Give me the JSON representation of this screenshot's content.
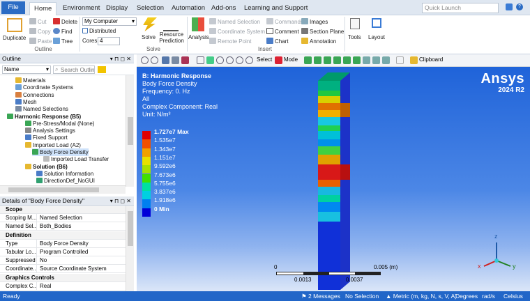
{
  "menubar": {
    "tabs": [
      "File",
      "Home",
      "Environment",
      "Display",
      "Selection",
      "Automation",
      "Add-ons",
      "Learning and Support"
    ],
    "quick_launch_placeholder": "Quick Launch"
  },
  "ribbon": {
    "duplicate": "Duplicate",
    "cut": "Cut",
    "delete": "Delete",
    "copy": "Copy",
    "find": "Find",
    "paste": "Paste",
    "tree": "Tree",
    "computer_value": "My Computer",
    "distributed": "Distributed",
    "cores_label": "Cores",
    "cores_value": "4",
    "solve": "Solve",
    "resource_prediction": "Resource Prediction",
    "analysis": "Analysis",
    "named_selection": "Named Selection",
    "coordinate_system": "Coordinate System",
    "remote_point": "Remote Point",
    "commands": "Commands",
    "comment": "Comment",
    "chart": "Chart",
    "images": "Images",
    "section_plane": "Section Plane",
    "annotation": "Annotation",
    "tools": "Tools",
    "layout": "Layout",
    "groups": [
      "Outline",
      "Solve",
      "Insert"
    ]
  },
  "toolbar": {
    "select": "Select",
    "mode": "Mode",
    "clipboard": "Clipboard"
  },
  "outline": {
    "title": "Outline",
    "name_label": "Name",
    "search_placeholder": "Search Outline",
    "nodes": [
      {
        "label": "Materials",
        "bold": false
      },
      {
        "label": "Coordinate Systems",
        "bold": false
      },
      {
        "label": "Connections",
        "bold": false
      },
      {
        "label": "Mesh",
        "bold": false
      },
      {
        "label": "Named Selections",
        "bold": false
      },
      {
        "label": "Harmonic Response (B5)",
        "bold": true
      },
      {
        "label": "Pre-Stress/Modal (None)",
        "bold": false
      },
      {
        "label": "Analysis Settings",
        "bold": false
      },
      {
        "label": "Fixed Support",
        "bold": false
      },
      {
        "label": "Imported Load (A2)",
        "bold": false
      },
      {
        "label": "Body Force Density",
        "bold": false
      },
      {
        "label": "Imported Load Transfer",
        "bold": false
      },
      {
        "label": "Solution (B6)",
        "bold": true
      },
      {
        "label": "Solution Information",
        "bold": false
      },
      {
        "label": "DirectionDef_NoGUI",
        "bold": false
      }
    ]
  },
  "details": {
    "title": "Details of \"Body Force Density\"",
    "rows": [
      {
        "section": "Scope"
      },
      {
        "key": "Scoping M...",
        "value": "Named Selection"
      },
      {
        "key": "Named Sel...",
        "value": "Both_Bodies"
      },
      {
        "section": "Definition"
      },
      {
        "key": "Type",
        "value": "Body Force Density"
      },
      {
        "key": "Tabular Lo...",
        "value": "Program Controlled"
      },
      {
        "key": "Suppressed",
        "value": "No"
      },
      {
        "key": "Coordinate...",
        "value": "Source Coordinate System"
      },
      {
        "section": "Graphics Controls"
      },
      {
        "key": "Complex C...",
        "value": "Real"
      }
    ]
  },
  "viewport": {
    "title": "B: Harmonic Response",
    "lines": [
      "Body Force Density",
      "Frequency: 0. Hz",
      "All",
      "Complex Component: Real",
      "Unit: N/m³"
    ],
    "legend": [
      "1.727e7 Max",
      "1.535e7",
      "1.343e7",
      "1.151e7",
      "9.592e6",
      "7.673e6",
      "5.755e6",
      "3.837e6",
      "1.918e6",
      "0 Min"
    ],
    "legend_colors": [
      "#e00000",
      "#f05000",
      "#f0a000",
      "#e8e000",
      "#a8e000",
      "#40e000",
      "#00e0a0",
      "#00d0e0",
      "#0080f0",
      "#0000d8"
    ],
    "logo": "Ansys",
    "version": "2024 R2",
    "scale_labels": [
      "0",
      "0.005 (m)",
      "0.0013",
      "0.0037"
    ],
    "axis": {
      "x": "x",
      "y": "y",
      "z": "z"
    }
  },
  "status": {
    "ready": "Ready",
    "messages": "2 Messages",
    "selection": "No Selection",
    "units": "Metric (m, kg, N, s, V, A)",
    "degrees": "Degrees",
    "rads": "rad/s",
    "temp": "Celsius"
  }
}
